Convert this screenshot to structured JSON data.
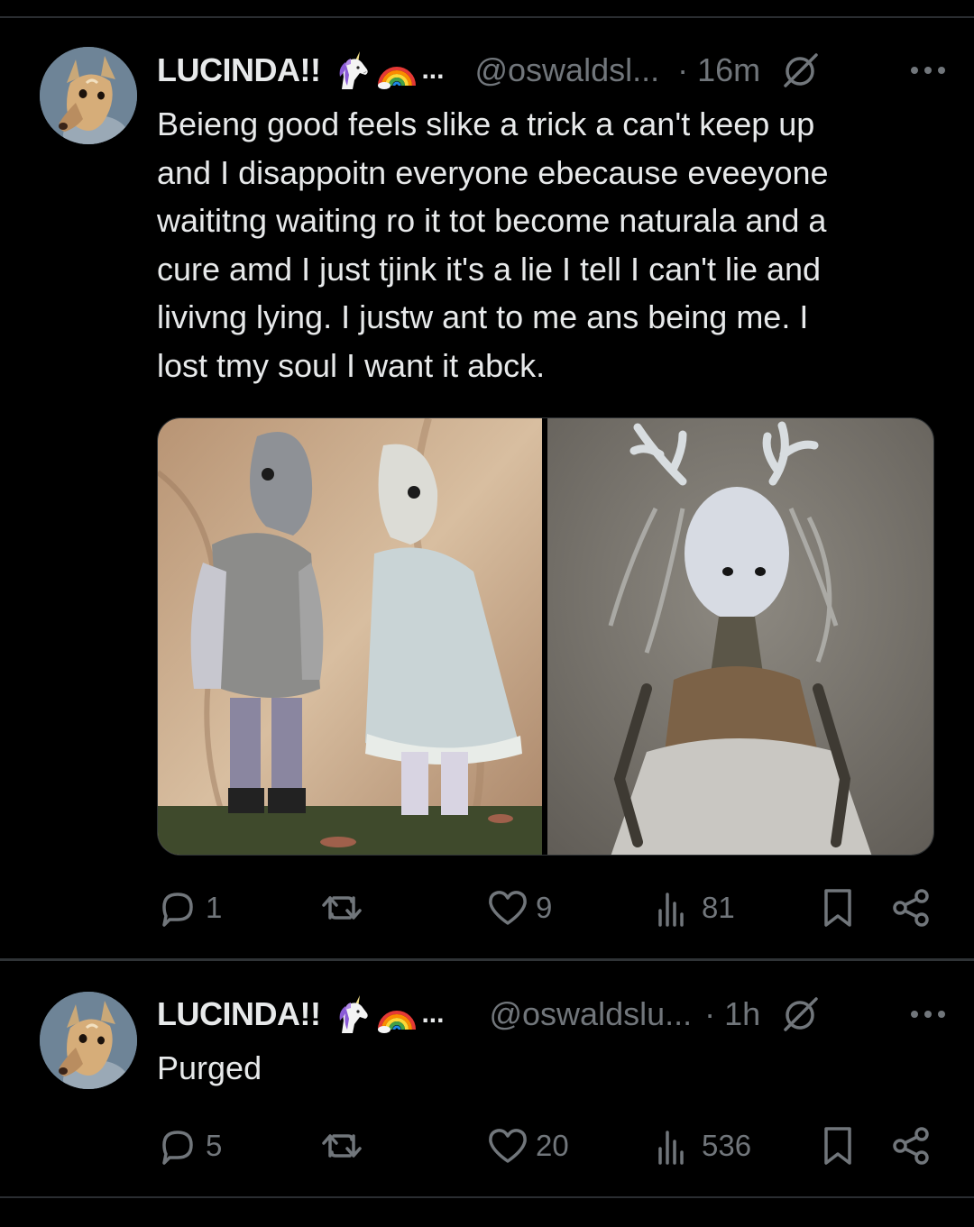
{
  "posts": [
    {
      "author": {
        "display_name": "LUCINDA!!",
        "name_trailing_ellipsis": "...",
        "handle": "@oswaldsl...",
        "avatar_icon": "fawn-avatar"
      },
      "timestamp": "· 16m",
      "text": "Beieng good feels slike a trick a can't keep up\nand I disappoitn everyone ebecause eveeyone\nwaititng waiting ro it tot become naturala and a\ncure amd I just tjink it's a lie I tell I can't lie and\nlivivng lying. I justw ant to me ans being me. I\nlost tmy soul I want it abck.",
      "media": [
        "horse-dolls-photo",
        "antlered-doll-photo"
      ],
      "actions": {
        "replies": "1",
        "reposts": "",
        "likes": "9",
        "views": "81"
      }
    },
    {
      "author": {
        "display_name": "LUCINDA!!",
        "name_trailing_ellipsis": "...",
        "handle": "@oswaldslu...",
        "avatar_icon": "fawn-avatar"
      },
      "timestamp": "· 1h",
      "text": "Purged",
      "actions": {
        "replies": "5",
        "reposts": "",
        "likes": "20",
        "views": "536"
      }
    }
  ],
  "icons": {
    "emoji": [
      "unicorn-emoji",
      "rainbow-emoji"
    ],
    "grok": "grok-icon",
    "more": "more-icon",
    "reply": "reply-icon",
    "repost": "repost-icon",
    "like": "like-icon",
    "views": "views-icon",
    "bookmark": "bookmark-icon",
    "share": "share-icon"
  },
  "colors": {
    "background": "#000000",
    "text_primary": "#e7e9ea",
    "text_secondary": "#71767b",
    "divider": "#2f3336"
  }
}
